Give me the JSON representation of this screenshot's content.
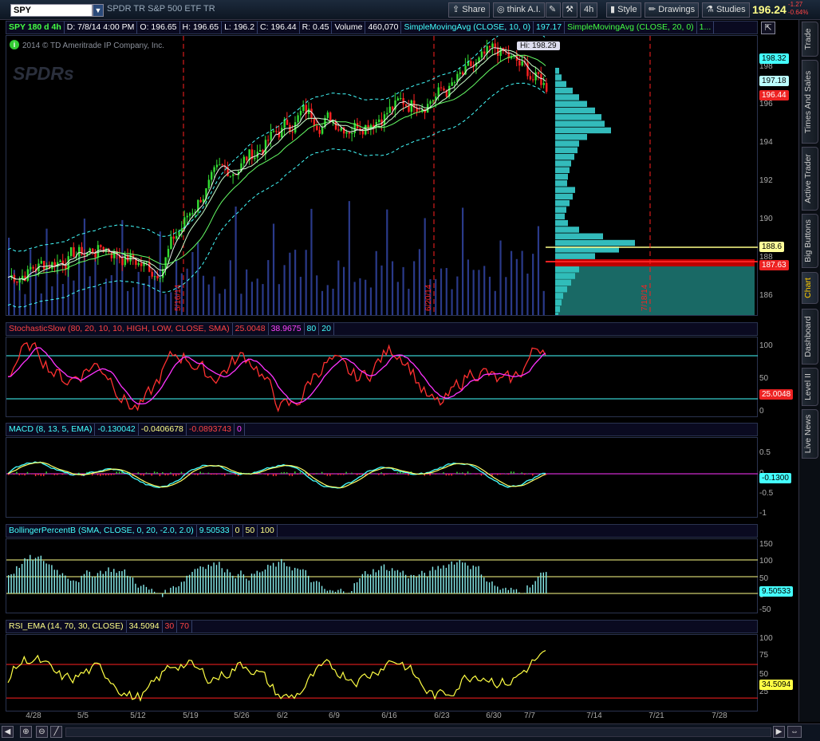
{
  "toolbar": {
    "symbol": "SPY",
    "symbol_name": "SPDR TR S&P 500 ETF TR",
    "share_label": "Share",
    "think_label": "think A.I.",
    "timeframe_label": "4h",
    "style_label": "Style",
    "drawings_label": "Drawings",
    "studies_label": "Studies",
    "last_price": "196.24",
    "change": "-1.27",
    "change_pct": "-0.64%"
  },
  "sidebar": {
    "tabs": [
      "Trade",
      "Times And Sales",
      "Active Trader",
      "Big Buttons",
      "Chart",
      "Dashboard",
      "Level II",
      "Live News"
    ]
  },
  "price_header": {
    "cells": [
      "SPY 180 d 4h",
      "D: 7/8/14 4:00 PM",
      "O: 196.65",
      "H: 196.65",
      "L: 196.2",
      "C: 196.44",
      "R: 0.45",
      "Volume",
      "460,070",
      "SimpleMovingAvg (CLOSE, 10, 0)",
      "197.17",
      "SimpleMovingAvg (CLOSE, 20, 0)",
      "1..."
    ]
  },
  "watermark": {
    "copyright": "2014 © TD Ameritrade IP Company, Inc.",
    "logo": "SPDRs"
  },
  "hi_label": "Hi: 198.29",
  "price_axis": {
    "ticks": [
      "198",
      "196",
      "194",
      "192",
      "190",
      "188",
      "186"
    ],
    "badges": [
      "198.32",
      "197.18",
      "196.44",
      "188.6",
      "187.63"
    ]
  },
  "date_markers": [
    "5/16/14",
    "6/20/14",
    "7/18/14"
  ],
  "stoch_header": {
    "cells": [
      "StochasticSlow (80, 20, 10, 10, HIGH, LOW, CLOSE, SMA)",
      "25.0048",
      "38.9675",
      "80",
      "20"
    ]
  },
  "stoch_axis": {
    "ticks": [
      "100",
      "50",
      "0"
    ],
    "badge": "25.0048"
  },
  "macd_header": {
    "cells": [
      "MACD (8, 13, 5, EMA)",
      "-0.130042",
      "-0.0406678",
      "-0.0893743",
      "0"
    ]
  },
  "macd_axis": {
    "ticks": [
      "0.5",
      "0",
      "-0.5",
      "-1"
    ],
    "badge": "-0.1300"
  },
  "bb_header": {
    "cells": [
      "BollingerPercentB (SMA, CLOSE, 0, 20, -2.0, 2.0)",
      "9.50533",
      "0",
      "50",
      "100"
    ]
  },
  "bb_axis": {
    "ticks": [
      "150",
      "100",
      "50",
      "0",
      "-50"
    ],
    "badge": "9.50533"
  },
  "rsi_header": {
    "cells": [
      "RSI_EMA (14, 70, 30, CLOSE)",
      "34.5094",
      "30",
      "70"
    ]
  },
  "rsi_axis": {
    "ticks": [
      "100",
      "75",
      "50",
      "25"
    ],
    "badge": "34.5094"
  },
  "x_axis": {
    "labels": [
      "4/28",
      "5/5",
      "5/12",
      "5/19",
      "5/26",
      "6/2",
      "6/9",
      "6/16",
      "6/23",
      "6/30",
      "7/7",
      "7/14",
      "7/21",
      "7/28"
    ]
  },
  "colors": {
    "up": "#33dd33",
    "down": "#ff2222",
    "volume": "#2a3a8a",
    "profile": "#33bbbb",
    "cyan": "#44ffff",
    "magenta": "#ff33ff",
    "yellow": "#ffff44",
    "red": "#ff2020"
  },
  "chart_data": [
    {
      "type": "candlestick",
      "title": "SPY 180 d 4h",
      "ylim": [
        185,
        199
      ],
      "x": [
        "4/28",
        "5/5",
        "5/12",
        "5/19",
        "5/26",
        "6/2",
        "6/9",
        "6/16",
        "6/23",
        "6/30",
        "7/7"
      ],
      "series": [
        {
          "name": "Close",
          "values": [
            186.9,
            187.8,
            188.4,
            187.2,
            191.3,
            193.1,
            195.1,
            194.6,
            195.5,
            196.3,
            198.2,
            196.44
          ]
        },
        {
          "name": "SimpleMovingAvg (CLOSE, 10, 0)",
          "last": 197.17
        },
        {
          "name": "Volume",
          "last": 460070
        }
      ],
      "annotations": [
        "Hi: 198.29",
        "5/16/14",
        "6/20/14",
        "7/18/14"
      ]
    },
    {
      "type": "line",
      "title": "StochasticSlow (80, 20, 10, 10, HIGH, LOW, CLOSE, SMA)",
      "ylim": [
        0,
        100
      ],
      "series": [
        {
          "name": "FullK",
          "last": 25.0048
        },
        {
          "name": "FullD",
          "last": 38.9675
        }
      ],
      "levels": [
        80,
        20
      ]
    },
    {
      "type": "line",
      "title": "MACD (8, 13, 5, EMA)",
      "ylim": [
        -1,
        0.8
      ],
      "series": [
        {
          "name": "Value",
          "last": -0.130042
        },
        {
          "name": "Avg",
          "last": -0.0406678
        },
        {
          "name": "Diff",
          "last": -0.0893743
        }
      ]
    },
    {
      "type": "bar",
      "title": "BollingerPercentB (SMA, CLOSE, 0, 20, -2.0, 2.0)",
      "ylim": [
        -50,
        160
      ],
      "series": [
        {
          "name": "PercentB",
          "last": 9.50533
        }
      ],
      "levels": [
        0,
        50,
        100
      ]
    },
    {
      "type": "line",
      "title": "RSI_EMA (14, 70, 30, CLOSE)",
      "ylim": [
        15,
        105
      ],
      "series": [
        {
          "name": "RSI",
          "last": 34.5094
        }
      ],
      "levels": [
        30,
        70
      ]
    }
  ]
}
